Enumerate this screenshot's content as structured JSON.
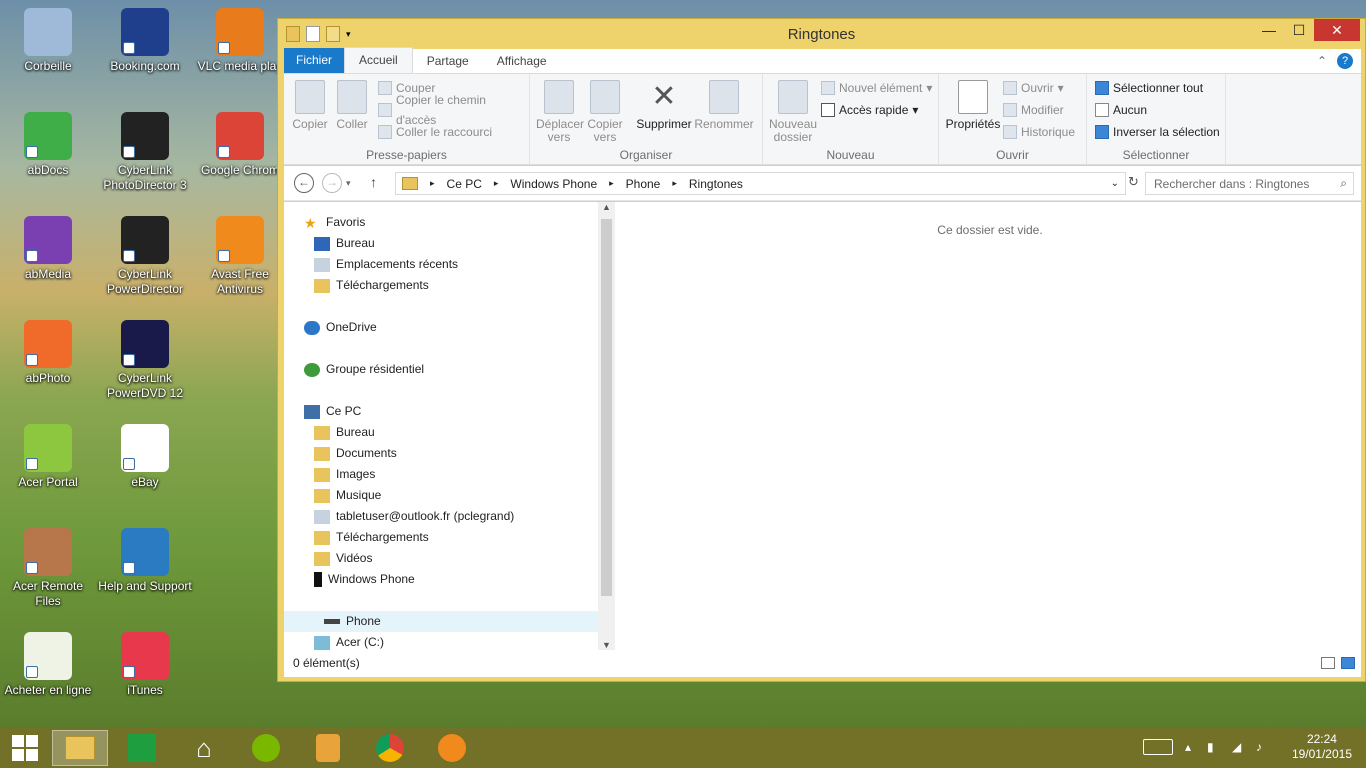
{
  "desktop": {
    "icons": [
      {
        "label": "Corbeille",
        "color": "#9fb9d8"
      },
      {
        "label": "Booking.com",
        "color": "#1f3e8c"
      },
      {
        "label": "VLC media play",
        "color": "#e87b1c"
      },
      {
        "label": "abDocs",
        "color": "#3fae49"
      },
      {
        "label": "CyberLink PhotoDirector 3",
        "color": "#222222"
      },
      {
        "label": "Google Chrom",
        "color": "#db4437"
      },
      {
        "label": "abMedia",
        "color": "#7a3fb0"
      },
      {
        "label": "CyberLink PowerDirector",
        "color": "#222222"
      },
      {
        "label": "Avast Free Antivirus",
        "color": "#f18a1c"
      },
      {
        "label": "abPhoto",
        "color": "#f06a2a"
      },
      {
        "label": "CyberLink PowerDVD 12",
        "color": "#1a1a4a"
      },
      {
        "label": "Acer Portal",
        "color": "#8dc63f"
      },
      {
        "label": "eBay",
        "color": "#ffffff"
      },
      {
        "label": "Acer Remote Files",
        "color": "#b7774a"
      },
      {
        "label": "Help and Support",
        "color": "#2a7bc1"
      },
      {
        "label": "Acheter en ligne",
        "color": "#eef3e6"
      },
      {
        "label": "iTunes",
        "color": "#e8394c"
      }
    ]
  },
  "window": {
    "title": "Ringtones",
    "controls": {
      "minimize": "—",
      "maximize": "☐",
      "close": "✕"
    }
  },
  "tabs": {
    "file": "Fichier",
    "home": "Accueil",
    "share": "Partage",
    "view": "Affichage"
  },
  "ribbon": {
    "clipboard": {
      "label": "Presse-papiers",
      "copy": "Copier",
      "paste": "Coller",
      "cut": "Couper",
      "copy_path": "Copier le chemin d'accès",
      "paste_shortcut": "Coller le raccourci"
    },
    "organize": {
      "label": "Organiser",
      "move_to": "Déplacer vers",
      "copy_to": "Copier vers",
      "delete": "Supprimer",
      "rename": "Renommer"
    },
    "new": {
      "label": "Nouveau",
      "new_folder": "Nouveau dossier",
      "new_item": "Nouvel élément",
      "easy_access": "Accès rapide"
    },
    "open": {
      "label": "Ouvrir",
      "properties": "Propriétés",
      "open": "Ouvrir",
      "edit": "Modifier",
      "history": "Historique"
    },
    "select": {
      "label": "Sélectionner",
      "select_all": "Sélectionner tout",
      "select_none": "Aucun",
      "invert": "Inverser la sélection"
    }
  },
  "address": {
    "path": [
      "Ce PC",
      "Windows Phone",
      "Phone",
      "Ringtones"
    ],
    "search_placeholder": "Rechercher dans : Ringtones"
  },
  "nav": {
    "favorites": "Favoris",
    "desktop": "Bureau",
    "recent": "Emplacements récents",
    "downloads": "Téléchargements",
    "onedrive": "OneDrive",
    "homegroup": "Groupe résidentiel",
    "thispc": "Ce PC",
    "pc_items": [
      "Bureau",
      "Documents",
      "Images",
      "Musique",
      "tabletuser@outlook.fr (pclegrand)",
      "Téléchargements",
      "Vidéos",
      "Windows Phone"
    ],
    "phone": "Phone",
    "drive": "Acer (C:)"
  },
  "content": {
    "empty_message": "Ce dossier est vide."
  },
  "status": {
    "count": "0 élément(s)"
  },
  "taskbar": {
    "time": "22:24",
    "date": "19/01/2015"
  }
}
